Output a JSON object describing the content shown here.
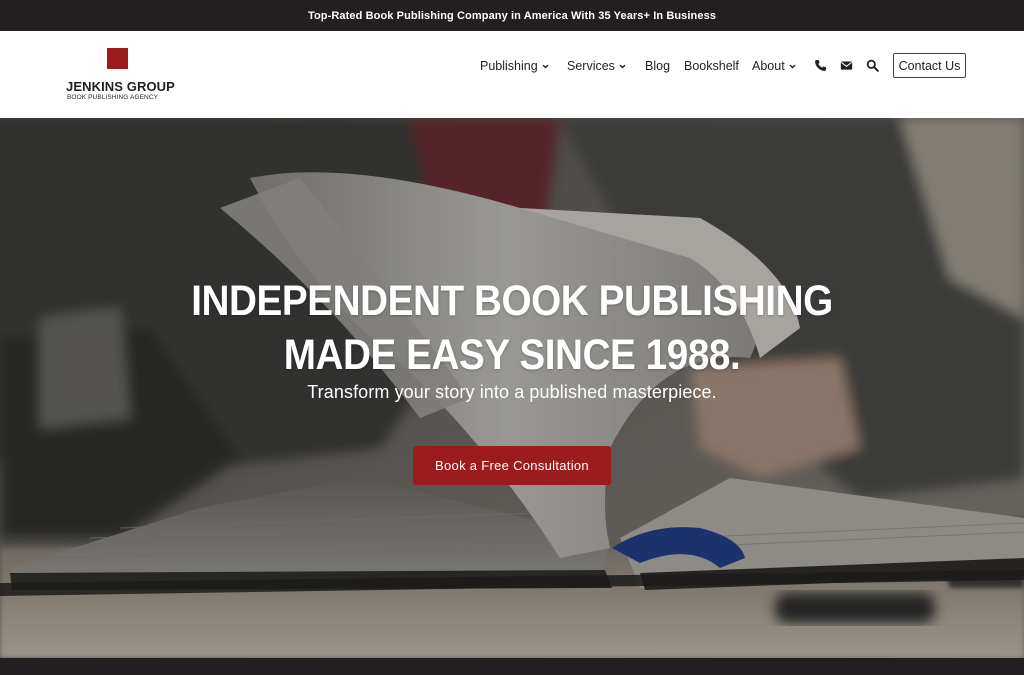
{
  "topbar": {
    "text": "Top-Rated Book Publishing Company in America With 35 Years+ In Business"
  },
  "logo": {
    "title": "JENKINS GROUP",
    "subtitle": "BOOK PUBLISHING AGENCY"
  },
  "nav": {
    "items": [
      {
        "label": "Publishing",
        "has_dropdown": true
      },
      {
        "label": "Services",
        "has_dropdown": true
      },
      {
        "label": "Blog",
        "has_dropdown": false
      },
      {
        "label": "Bookshelf",
        "has_dropdown": false
      },
      {
        "label": "About",
        "has_dropdown": true
      }
    ],
    "icons": [
      "phone-icon",
      "envelope-icon",
      "search-icon"
    ],
    "contact_label": "Contact Us"
  },
  "hero": {
    "heading_line1": "INDEPENDENT BOOK PUBLISHING",
    "heading_line2": "MADE EASY SINCE 1988.",
    "subheading": "Transform your story into a published masterpiece.",
    "cta_label": "Book a Free Consultation"
  },
  "colors": {
    "brand_red": "#9b1b1f",
    "dark": "#231f20",
    "white": "#ffffff"
  }
}
